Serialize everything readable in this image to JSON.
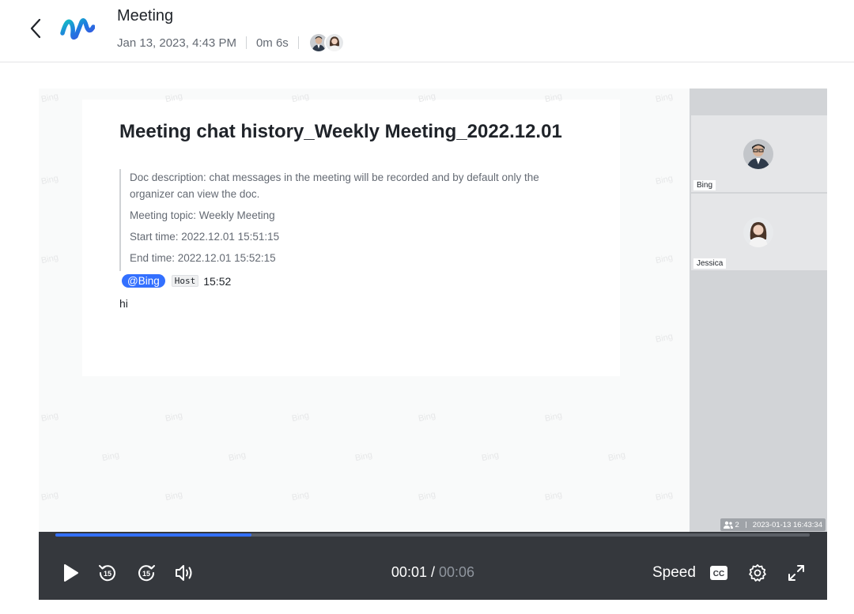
{
  "header": {
    "title": "Meeting",
    "date": "Jan 13, 2023, 4:43 PM",
    "duration": "0m 6s"
  },
  "document": {
    "title": "Meeting chat history_Weekly Meeting_2022.12.01",
    "description": "Doc description: chat messages in the meeting will be recorded and by default only the organizer can view the doc.",
    "topic": "Meeting topic: Weekly Meeting",
    "start_time": "Start time: 2022.12.01 15:51:15",
    "end_time": "End time: 2022.12.01 15:52:15",
    "mention": "@Bing",
    "host_tag": "Host",
    "message_time": "15:52",
    "message_text": "hi",
    "watermark": "Bing"
  },
  "participants": [
    {
      "name": "Bing"
    },
    {
      "name": "Jessica"
    }
  ],
  "recording_stats": {
    "participant_count": "2",
    "timestamp": "2023-01-13 16:43:34"
  },
  "player": {
    "current_time": "00:01",
    "separator": "/",
    "total_time": "00:06",
    "progress_fraction": 0.26,
    "speed_label": "Speed",
    "accent_color": "#3370ff"
  }
}
